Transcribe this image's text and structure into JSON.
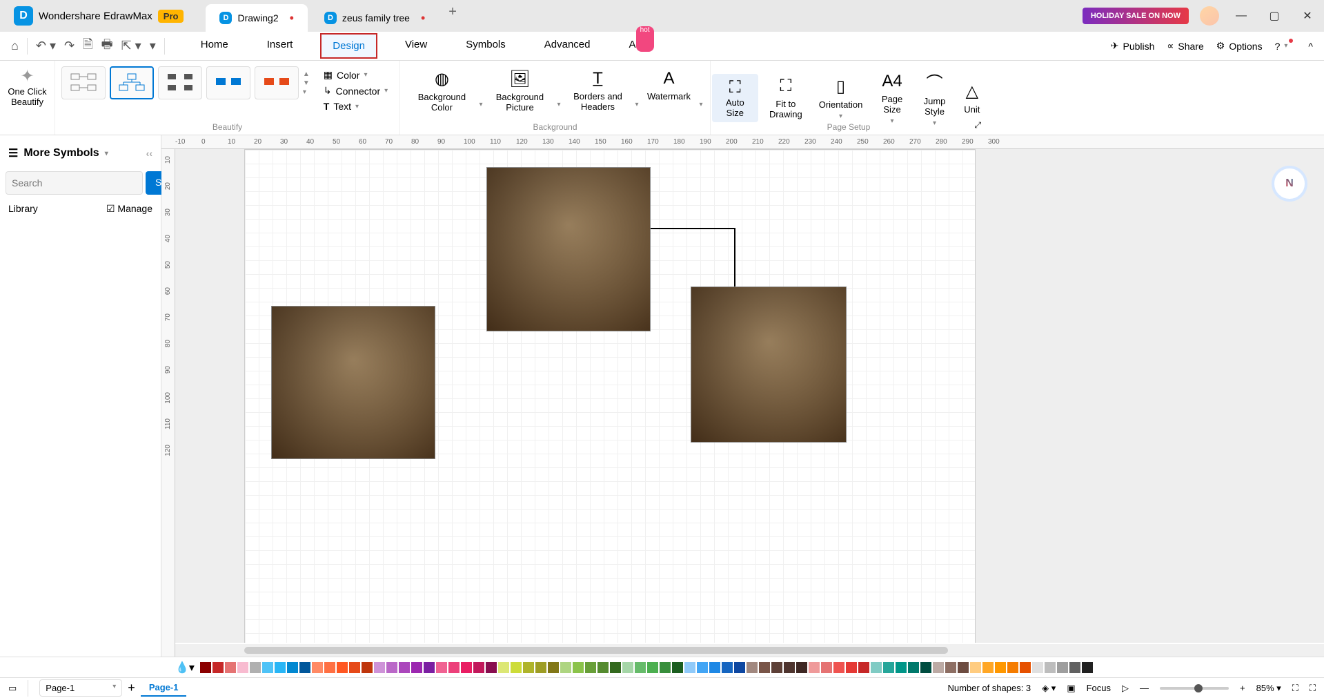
{
  "app": {
    "name": "Wondershare EdrawMax",
    "pro": "Pro"
  },
  "tabs": [
    {
      "label": "Drawing2",
      "dirty": true
    },
    {
      "label": "zeus family tree",
      "dirty": true
    }
  ],
  "holiday": "HOLIDAY SALE ON NOW",
  "menu": {
    "items": [
      "Home",
      "Insert",
      "Design",
      "View",
      "Symbols",
      "Advanced",
      "AI"
    ],
    "active": "Design",
    "hot": "hot"
  },
  "toolbar_right": {
    "publish": "Publish",
    "share": "Share",
    "options": "Options"
  },
  "ribbon": {
    "one_click": "One Click\nBeautify",
    "beautify_label": "Beautify",
    "color": "Color",
    "connector": "Connector",
    "text": "Text",
    "bg_color": "Background Color",
    "bg_picture": "Background Picture",
    "borders": "Borders and Headers",
    "watermark": "Watermark",
    "background_label": "Background",
    "auto_size": "Auto Size",
    "fit": "Fit to Drawing",
    "orientation": "Orientation",
    "page_size": "Page Size",
    "jump_style": "Jump Style",
    "unit": "Unit",
    "page_setup_label": "Page Setup"
  },
  "sidebar": {
    "title": "More Symbols",
    "search_placeholder": "Search",
    "search_btn": "Search",
    "library": "Library",
    "manage": "Manage"
  },
  "ruler_h": [
    "-10",
    "0",
    "10",
    "20",
    "30",
    "40",
    "50",
    "60",
    "70",
    "80",
    "90",
    "100",
    "110",
    "120",
    "130",
    "140",
    "150",
    "160",
    "170",
    "180",
    "190",
    "200",
    "210",
    "220",
    "230",
    "240",
    "250",
    "260",
    "270",
    "280",
    "290",
    "300"
  ],
  "ruler_v": [
    "10",
    "20",
    "30",
    "40",
    "50",
    "60",
    "70",
    "80",
    "90",
    "100",
    "110",
    "120"
  ],
  "status": {
    "page_dropdown": "Page-1",
    "page_tab": "Page-1",
    "shapes": "Number of shapes: 3",
    "focus": "Focus",
    "zoom": "85%"
  },
  "colors": [
    "#8b0000",
    "#c62828",
    "#e57373",
    "#f8bbd0",
    "#b0b0b0",
    "#4fc3f7",
    "#29b6f6",
    "#0288d1",
    "#01579b",
    "#ff8a65",
    "#ff7043",
    "#ff5722",
    "#e64a19",
    "#bf360c",
    "#ce93d8",
    "#ba68c8",
    "#ab47bc",
    "#9c27b0",
    "#7b1fa2",
    "#f06292",
    "#ec407a",
    "#e91e63",
    "#c2185b",
    "#880e4f",
    "#dce775",
    "#cddc39",
    "#afb42b",
    "#9e9d24",
    "#827717",
    "#aed581",
    "#8bc34a",
    "#689f38",
    "#558b2f",
    "#33691e",
    "#a5d6a7",
    "#66bb6a",
    "#4caf50",
    "#388e3c",
    "#1b5e20",
    "#90caf9",
    "#42a5f5",
    "#1e88e5",
    "#1565c0",
    "#0d47a1",
    "#a1887f",
    "#795548",
    "#5d4037",
    "#4e342e",
    "#3e2723",
    "#ef9a9a",
    "#e57373",
    "#ef5350",
    "#e53935",
    "#c62828",
    "#80cbc4",
    "#26a69a",
    "#009688",
    "#00796b",
    "#004d40",
    "#bcaaa4",
    "#8d6e63",
    "#6d4c41",
    "#ffcc80",
    "#ffa726",
    "#ff9800",
    "#f57c00",
    "#e65100",
    "#e0e0e0",
    "#bdbdbd",
    "#9e9e9e",
    "#616161",
    "#212121"
  ]
}
